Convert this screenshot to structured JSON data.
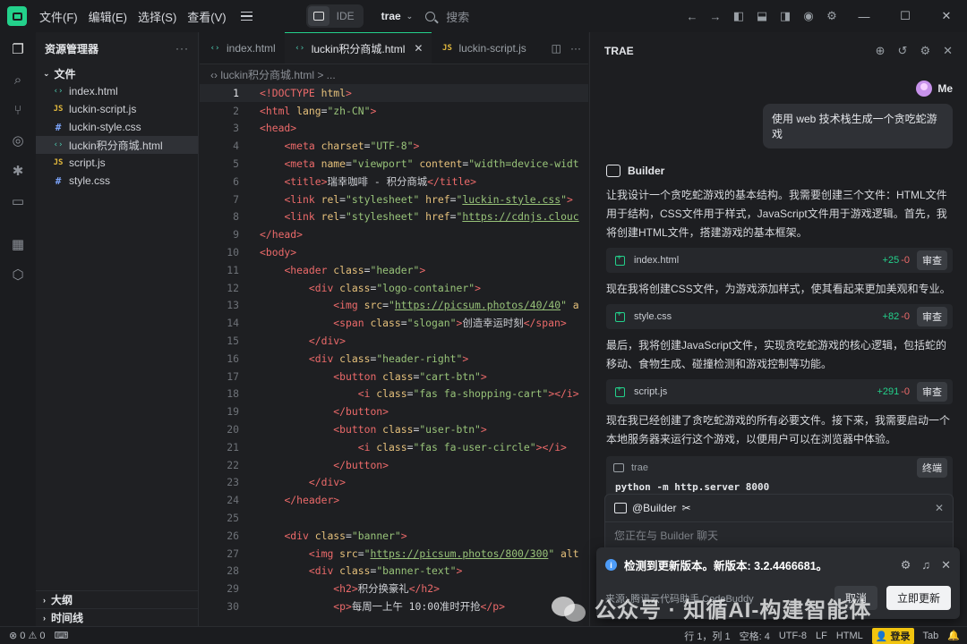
{
  "titlebar": {
    "menu": [
      "文件(F)",
      "编辑(E)",
      "选择(S)",
      "查看(V)"
    ],
    "ide_label": "IDE",
    "project": "trae",
    "search_placeholder": "搜索"
  },
  "sidebar": {
    "title": "资源管理器",
    "more": "···",
    "folder": "文件",
    "files": [
      {
        "icon": "‹›",
        "type": "html",
        "name": "index.html"
      },
      {
        "icon": "JS",
        "type": "js",
        "name": "luckin-script.js"
      },
      {
        "icon": "#",
        "type": "css",
        "name": "luckin-style.css"
      },
      {
        "icon": "‹›",
        "type": "html",
        "name": "luckin积分商城.html"
      },
      {
        "icon": "JS",
        "type": "js",
        "name": "script.js"
      },
      {
        "icon": "#",
        "type": "css",
        "name": "style.css"
      }
    ],
    "outline": "大纲",
    "timeline": "时间线"
  },
  "editor": {
    "tabs": [
      {
        "icon": "‹›",
        "label": "index.html"
      },
      {
        "icon": "‹›",
        "label": "luckin积分商城.html"
      },
      {
        "icon": "JS",
        "label": "luckin-script.js"
      }
    ],
    "breadcrumb": "‹› luckin积分商城.html > ...",
    "current_line": 1
  },
  "chat": {
    "title": "TRAE",
    "user_name": "Me",
    "user_message": "使用 web 技术栈生成一个贪吃蛇游戏",
    "agent_name": "Builder",
    "msg1": "让我设计一个贪吃蛇游戏的基本结构。我需要创建三个文件：HTML文件用于结构，CSS文件用于样式，JavaScript文件用于游戏逻辑。首先，我将创建HTML文件，搭建游戏的基本框架。",
    "file1": {
      "name": "index.html",
      "add": "+25",
      "del": "-0",
      "btn": "审查"
    },
    "msg2": "现在我将创建CSS文件，为游戏添加样式，使其看起来更加美观和专业。",
    "file2": {
      "name": "style.css",
      "add": "+82",
      "del": "-0",
      "btn": "审查"
    },
    "msg3": "最后，我将创建JavaScript文件，实现贪吃蛇游戏的核心逻辑，包括蛇的移动、食物生成、碰撞检测和游戏控制等功能。",
    "file3": {
      "name": "script.js",
      "add": "+291",
      "del": "-0",
      "btn": "审查"
    },
    "msg4": "现在我已经创建了贪吃蛇游戏的所有必要文件。接下来，我需要启动一个本地服务器来运行这个游戏，以便用户可以在浏览器中体验。",
    "terminal": {
      "label": "trae",
      "btn": "终端",
      "command": "python -m http.server 8000"
    },
    "input_agent": "@Builder",
    "input_placeholder": "您正在与 Builder 聊天"
  },
  "notification": {
    "text": "检测到更新版本。新版本: 3.2.4466681。",
    "source": "来源: 腾讯云代码助手 CodeBuddy",
    "cancel": "取消",
    "update": "立即更新"
  },
  "watermark": "公众号 · 知循AI-构建智能体",
  "statusbar": {
    "problems": "⊗ 0 ⚠ 0",
    "position": "行 1，列 1",
    "spaces": "空格: 4",
    "encoding": "UTF-8",
    "eol": "LF",
    "language": "HTML",
    "login": "登录",
    "tab": "Tab"
  }
}
